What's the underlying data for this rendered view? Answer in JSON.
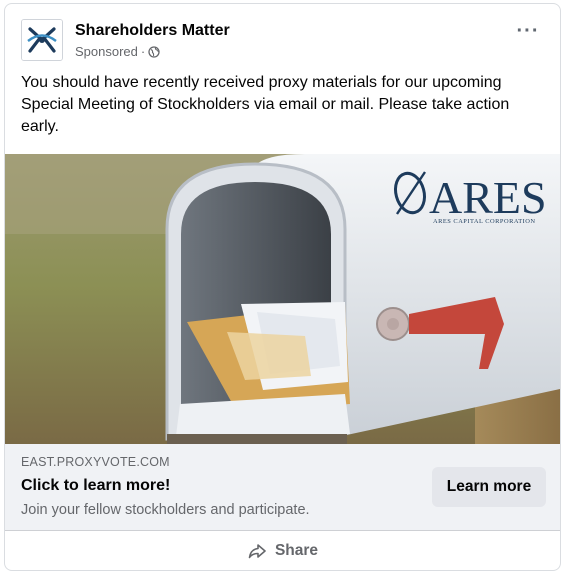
{
  "post": {
    "page_name": "Shareholders Matter",
    "sponsored_label": "Sponsored",
    "separator": "·",
    "more_label": "···",
    "text": "You should have recently received proxy materials for our upcoming Special Meeting of Stockholders via email or mail. Please take action early."
  },
  "ad_image": {
    "brand_name": "ARES",
    "brand_tagline": "ARES CAPITAL CORPORATION"
  },
  "link_preview": {
    "domain": "EAST.PROXYVOTE.COM",
    "headline": "Click to learn more!",
    "description": "Join your fellow stockholders and participate.",
    "cta_label": "Learn more"
  },
  "actions": {
    "share_label": "Share"
  },
  "colors": {
    "brand_navy": "#1d3b5c",
    "flag_red": "#c4473b",
    "link_bg": "#f0f2f5",
    "secondary_text": "#65676b"
  },
  "icons": {
    "avatar": "shareholders-matter-logo-icon",
    "audience": "globe-icon",
    "more": "more-options-icon",
    "share": "share-arrow-icon"
  }
}
